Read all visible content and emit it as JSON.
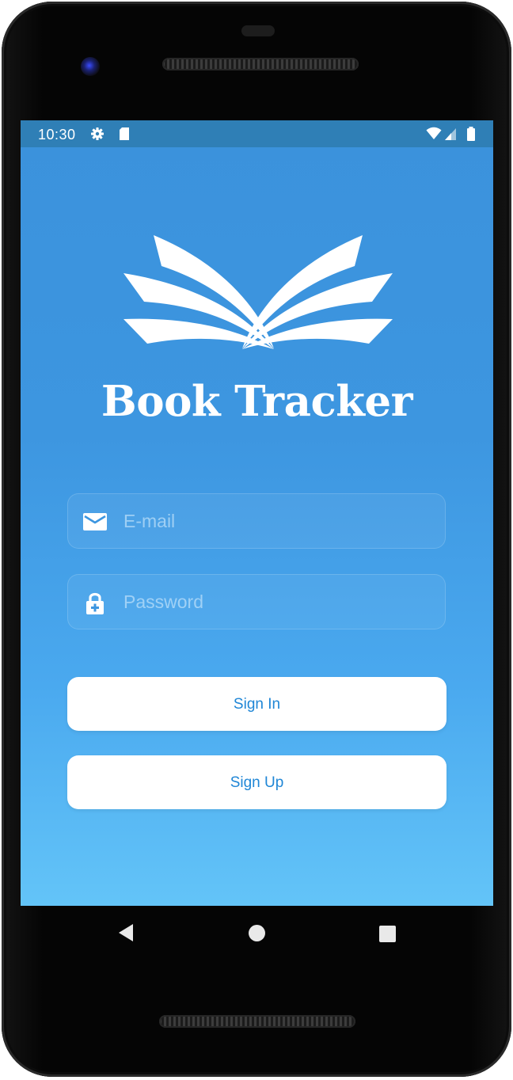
{
  "status_bar": {
    "time": "10:30",
    "icons": [
      "gear-icon",
      "sd-card-icon",
      "wifi-icon",
      "cell-signal-icon",
      "battery-icon"
    ]
  },
  "app": {
    "logo_icon": "open-book-icon",
    "title": "Book Tracker"
  },
  "form": {
    "email": {
      "icon": "mail-icon",
      "placeholder": "E-mail",
      "value": ""
    },
    "password": {
      "icon": "lock-icon",
      "placeholder": "Password",
      "value": ""
    },
    "sign_in_label": "Sign In",
    "sign_up_label": "Sign Up"
  },
  "nav_bar": {
    "icons": [
      "back-icon",
      "home-icon",
      "recents-icon"
    ]
  },
  "colors": {
    "status_bar": "#2f7fb6",
    "background_top": "#3b92dc",
    "background_bottom": "#63c4f8",
    "button_text": "#1f86d6"
  }
}
